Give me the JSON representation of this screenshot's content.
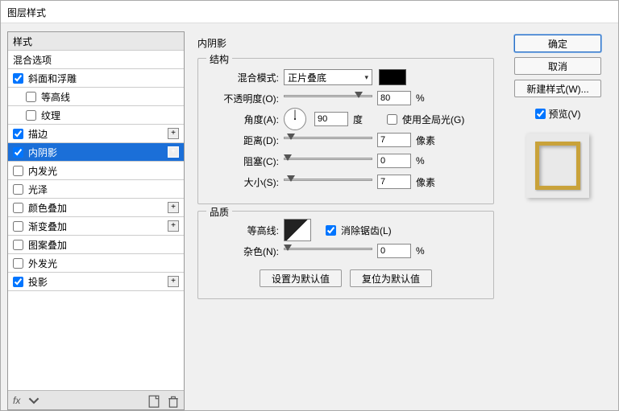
{
  "window_title": "图层样式",
  "sidebar": {
    "header": "样式",
    "blend_options": "混合选项",
    "items": [
      {
        "label": "斜面和浮雕",
        "checked": true,
        "plus": false,
        "indent": 0
      },
      {
        "label": "等高线",
        "checked": false,
        "plus": false,
        "indent": 1
      },
      {
        "label": "纹理",
        "checked": false,
        "plus": false,
        "indent": 1
      },
      {
        "label": "描边",
        "checked": true,
        "plus": true,
        "indent": 0
      },
      {
        "label": "内阴影",
        "checked": true,
        "plus": true,
        "indent": 0,
        "selected": true
      },
      {
        "label": "内发光",
        "checked": false,
        "plus": false,
        "indent": 0
      },
      {
        "label": "光泽",
        "checked": false,
        "plus": false,
        "indent": 0
      },
      {
        "label": "颜色叠加",
        "checked": false,
        "plus": true,
        "indent": 0
      },
      {
        "label": "渐变叠加",
        "checked": false,
        "plus": true,
        "indent": 0
      },
      {
        "label": "图案叠加",
        "checked": false,
        "plus": false,
        "indent": 0
      },
      {
        "label": "外发光",
        "checked": false,
        "plus": false,
        "indent": 0
      },
      {
        "label": "投影",
        "checked": true,
        "plus": true,
        "indent": 0
      }
    ],
    "footer_fx": "fx"
  },
  "panel": {
    "title": "内阴影",
    "structure_legend": "结构",
    "blend_mode_label": "混合模式:",
    "blend_mode_value": "正片叠底",
    "opacity_label": "不透明度(O):",
    "opacity_value": "80",
    "opacity_unit": "%",
    "angle_label": "角度(A):",
    "angle_value": "90",
    "angle_unit": "度",
    "global_light_label": "使用全局光(G)",
    "distance_label": "距离(D):",
    "distance_value": "7",
    "distance_unit": "像素",
    "choke_label": "阻塞(C):",
    "choke_value": "0",
    "choke_unit": "%",
    "size_label": "大小(S):",
    "size_value": "7",
    "size_unit": "像素",
    "quality_legend": "品质",
    "contour_label": "等高线:",
    "antialias_label": "消除锯齿(L)",
    "noise_label": "杂色(N):",
    "noise_value": "0",
    "noise_unit": "%",
    "make_default": "设置为默认值",
    "reset_default": "复位为默认值"
  },
  "right": {
    "ok": "确定",
    "cancel": "取消",
    "new_style": "新建样式(W)...",
    "preview": "预览(V)"
  }
}
